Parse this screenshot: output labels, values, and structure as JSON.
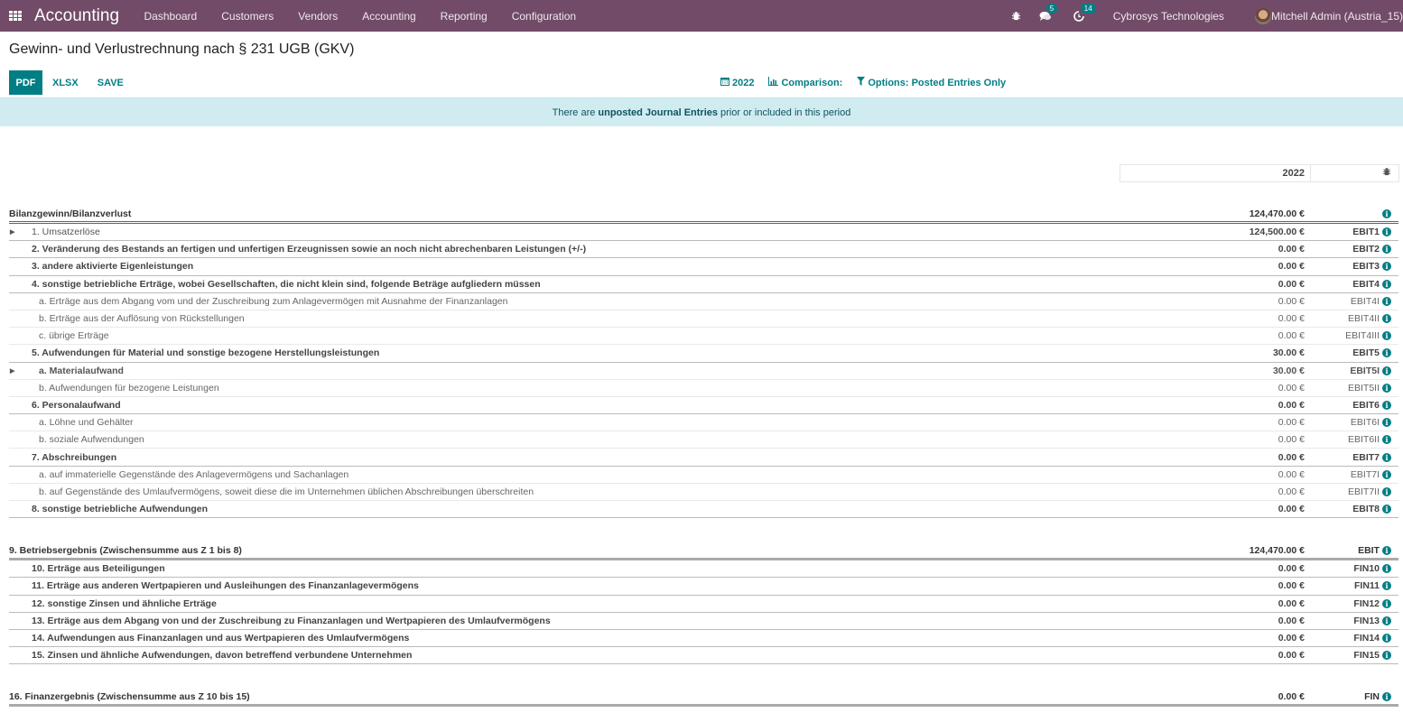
{
  "navbar": {
    "app_name": "Accounting",
    "menu": [
      "Dashboard",
      "Customers",
      "Vendors",
      "Accounting",
      "Reporting",
      "Configuration"
    ],
    "messages_count": "5",
    "activities_count": "14",
    "company": "Cybrosys Technologies",
    "user": "Mitchell Admin (Austria_15)"
  },
  "page": {
    "title": "Gewinn- und Verlustrechnung nach § 231 UGB (GKV)",
    "buttons": {
      "pdf": "PDF",
      "xlsx": "XLSX",
      "save": "SAVE"
    },
    "filters": {
      "date": "2022",
      "comparison": "Comparison:",
      "options": "Options: Posted Entries Only"
    },
    "alert": {
      "prefix": "There are",
      "bold": "unposted Journal Entries",
      "suffix": "prior or included in this period"
    },
    "column_header": "2022"
  },
  "rows": [
    {
      "type": "lvl0",
      "label": "Bilanzgewinn/Bilanzverlust",
      "amount": "124,470.00 €",
      "code": ""
    },
    {
      "type": "lvl1",
      "caret": true,
      "label": "1. Umsatzerlöse",
      "amount": "124,500.00 €",
      "code": "EBIT1",
      "light": true
    },
    {
      "type": "lvl1",
      "label": "2. Veränderung des Bestands an fertigen und unfertigen Erzeugnissen sowie an noch nicht abrechenbaren Leistungen (+/-)",
      "amount": "0.00 €",
      "code": "EBIT2"
    },
    {
      "type": "lvl1",
      "label": "3. andere aktivierte Eigenleistungen",
      "amount": "0.00 €",
      "code": "EBIT3"
    },
    {
      "type": "lvl1",
      "label": "4. sonstige betriebliche Erträge, wobei Gesellschaften, die nicht klein sind, folgende Beträge aufgliedern müssen",
      "amount": "0.00 €",
      "code": "EBIT4"
    },
    {
      "type": "lvl2",
      "label": "a. Erträge aus dem Abgang vom und der Zuschreibung zum Anlagevermögen mit Ausnahme der Finanzanlagen",
      "amount": "0.00 €",
      "code": "EBIT4I"
    },
    {
      "type": "lvl2",
      "label": "b. Erträge aus der Auflösung von Rückstellungen",
      "amount": "0.00 €",
      "code": "EBIT4II"
    },
    {
      "type": "lvl2",
      "label": "c. übrige Erträge",
      "amount": "0.00 €",
      "code": "EBIT4III"
    },
    {
      "type": "lvl1",
      "label": "5. Aufwendungen für Material und sonstige bezogene Herstellungsleistungen",
      "amount": "30.00 €",
      "code": "EBIT5"
    },
    {
      "type": "lvl2 bold",
      "caret": true,
      "label": "a. Materialaufwand",
      "amount": "30.00 €",
      "code": "EBIT5I"
    },
    {
      "type": "lvl2",
      "label": "b. Aufwendungen für bezogene Leistungen",
      "amount": "0.00 €",
      "code": "EBIT5II"
    },
    {
      "type": "lvl1",
      "label": "6. Personalaufwand",
      "amount": "0.00 €",
      "code": "EBIT6"
    },
    {
      "type": "lvl2",
      "label": "a. Löhne und Gehälter",
      "amount": "0.00 €",
      "code": "EBIT6I"
    },
    {
      "type": "lvl2",
      "label": "b. soziale Aufwendungen",
      "amount": "0.00 €",
      "code": "EBIT6II"
    },
    {
      "type": "lvl1",
      "label": "7. Abschreibungen",
      "amount": "0.00 €",
      "code": "EBIT7"
    },
    {
      "type": "lvl2",
      "label": "a. auf immaterielle Gegenstände des Anlagevermögens und Sachanlagen",
      "amount": "0.00 €",
      "code": "EBIT7I"
    },
    {
      "type": "lvl2",
      "label": "b. auf Gegenstände des Umlaufvermögens, soweit diese die im Unternehmen üblichen Abschreibungen überschreiten",
      "amount": "0.00 €",
      "code": "EBIT7II"
    },
    {
      "type": "lvl1",
      "label": "8. sonstige betriebliche Aufwendungen",
      "amount": "0.00 €",
      "code": "EBIT8"
    },
    {
      "type": "spacer"
    },
    {
      "type": "total",
      "label": "9. Betriebsergebnis (Zwischensumme aus Z 1 bis 8)",
      "amount": "124,470.00 €",
      "code": "EBIT"
    },
    {
      "type": "lvl1",
      "label": "10. Erträge aus Beteiligungen",
      "amount": "0.00 €",
      "code": "FIN10"
    },
    {
      "type": "lvl1",
      "label": "11. Erträge aus anderen Wertpapieren und Ausleihungen des Finanzanlagevermögens",
      "amount": "0.00 €",
      "code": "FIN11"
    },
    {
      "type": "lvl1",
      "label": "12. sonstige Zinsen und ähnliche Erträge",
      "amount": "0.00 €",
      "code": "FIN12"
    },
    {
      "type": "lvl1",
      "label": "13. Erträge aus dem Abgang von und der Zuschreibung zu Finanzanlagen und Wertpapieren des Umlaufvermögens",
      "amount": "0.00 €",
      "code": "FIN13"
    },
    {
      "type": "lvl1",
      "label": "14. Aufwendungen aus Finanzanlagen und aus Wertpapieren des Umlaufvermögens",
      "amount": "0.00 €",
      "code": "FIN14"
    },
    {
      "type": "lvl1",
      "label": "15. Zinsen und ähnliche Aufwendungen, davon betreffend verbundene Unternehmen",
      "amount": "0.00 €",
      "code": "FIN15"
    },
    {
      "type": "spacer"
    },
    {
      "type": "total",
      "label": "16. Finanzergebnis (Zwischensumme aus Z 10 bis 15)",
      "amount": "0.00 €",
      "code": "FIN"
    }
  ]
}
